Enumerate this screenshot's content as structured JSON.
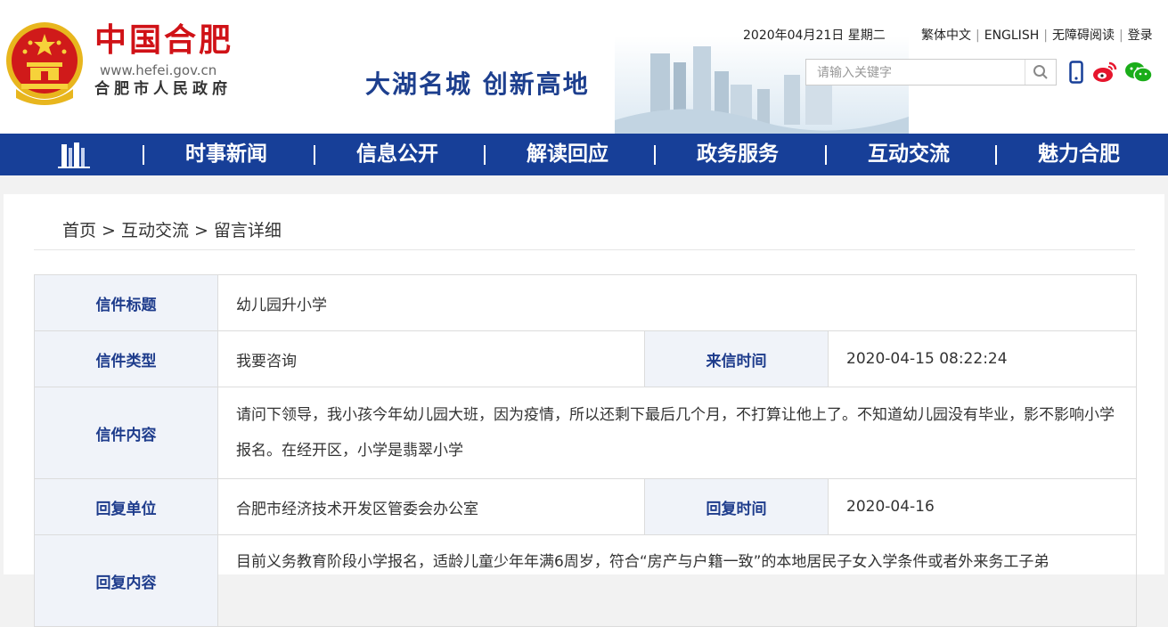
{
  "header": {
    "logo_cn": "中国合肥",
    "logo_url": "www.hefei.gov.cn",
    "logo_gov": "合肥市人民政府",
    "slogan": "大湖名城  创新高地",
    "date": "2020年04月21日 星期二",
    "links": [
      "繁体中文",
      "ENGLISH",
      "无障碍阅读",
      "登录"
    ],
    "search_placeholder": "请输入关键字",
    "icons": [
      "emblem-icon",
      "search-icon",
      "mobile-icon",
      "weibo-icon",
      "wechat-icon"
    ]
  },
  "nav": {
    "home_icon": "home-icon",
    "items": [
      "时事新闻",
      "信息公开",
      "解读回应",
      "政务服务",
      "互动交流",
      "魅力合肥"
    ]
  },
  "breadcrumb": {
    "items": [
      "首页",
      "互动交流",
      "留言详细"
    ],
    "separator": ">"
  },
  "letter": {
    "title_label": "信件标题",
    "title_value": "幼儿园升小学",
    "type_label": "信件类型",
    "type_value": "我要咨询",
    "time_label": "来信时间",
    "time_value": "2020-04-15 08:22:24",
    "content_label": "信件内容",
    "content_value": "请问下领导，我小孩今年幼儿园大班，因为疫情，所以还剩下最后几个月，不打算让他上了。不知道幼儿园没有毕业，影不影响小学报名。在经开区，小学是翡翠小学",
    "reply_unit_label": "回复单位",
    "reply_unit_value": "合肥市经济技术开发区管委会办公室",
    "reply_time_label": "回复时间",
    "reply_time_value": "2020-04-16",
    "reply_content_label": "回复内容",
    "reply_content_value": "目前义务教育阶段小学报名，适龄儿童少年年满6周岁，符合“房产与户籍一致”的本地居民子女入学条件或者外来务工子弟"
  },
  "colors": {
    "brand_red": "#d01217",
    "nav_blue": "#173f98",
    "label_blue": "#1e3c8c",
    "label_bg": "#f0f3f9"
  }
}
